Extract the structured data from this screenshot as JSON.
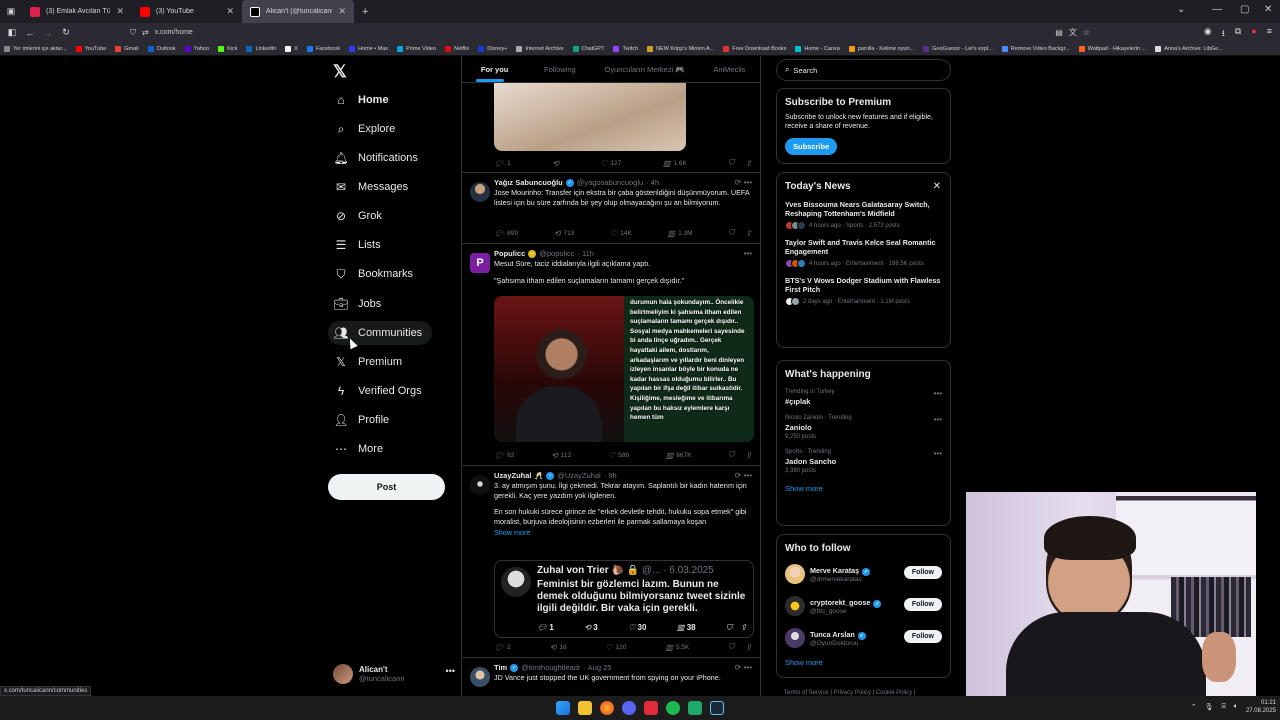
{
  "browser": {
    "tabs": [
      {
        "title": "(3) Emlak Avcıları Türkiye - 8. B",
        "fav_color": "#e0234e"
      },
      {
        "title": "(3) YouTube",
        "fav_color": "#ff0000"
      },
      {
        "title": "Alican't (@tuncalicann) / X",
        "fav_color": "#ffffff",
        "active": true
      }
    ],
    "new_tab": "+",
    "url": "x.com/home",
    "bookmarks": [
      {
        "label": "Yer imlerini içe aktar...",
        "color": "#888"
      },
      {
        "label": "YouTube",
        "color": "#ff0000"
      },
      {
        "label": "Gmail",
        "color": "#ea4335"
      },
      {
        "label": "Outlook",
        "color": "#0a64d6"
      },
      {
        "label": "Yahoo",
        "color": "#6001d2"
      },
      {
        "label": "Kick",
        "color": "#53fc18"
      },
      {
        "label": "LinkedIn",
        "color": "#0a66c2"
      },
      {
        "label": "X",
        "color": "#ffffff"
      },
      {
        "label": "Facebook",
        "color": "#1877f2"
      },
      {
        "label": "Home • Max",
        "color": "#2c3cff"
      },
      {
        "label": "Prime Video",
        "color": "#00a8e1"
      },
      {
        "label": "Netflix",
        "color": "#e50914"
      },
      {
        "label": "Disney+",
        "color": "#113ccf"
      },
      {
        "label": "Internet Archive",
        "color": "#aaaaaa"
      },
      {
        "label": "ChatGPT",
        "color": "#10a37f"
      },
      {
        "label": "Twitch",
        "color": "#9146ff"
      },
      {
        "label": "NEW Kripp's Minion A...",
        "color": "#c9a227"
      },
      {
        "label": "Free Download Books",
        "color": "#d33"
      },
      {
        "label": "Home - Canva",
        "color": "#00c4cc"
      },
      {
        "label": "parolla - Kelime oyun...",
        "color": "#f39c12"
      },
      {
        "label": "GeoGuessr - Let's expl...",
        "color": "#5b2d8e"
      },
      {
        "label": "Remove Video Backgr...",
        "color": "#4a8cff"
      },
      {
        "label": "Wattpad - Hikayelerin ...",
        "color": "#ff6122"
      },
      {
        "label": "Anna's Archive: LibGe...",
        "color": "#dddddd"
      }
    ]
  },
  "leftnav": {
    "items": [
      {
        "label": "Home",
        "icon": "home-icon"
      },
      {
        "label": "Explore",
        "icon": "search-icon"
      },
      {
        "label": "Notifications",
        "icon": "bell-icon"
      },
      {
        "label": "Messages",
        "icon": "mail-icon"
      },
      {
        "label": "Grok",
        "icon": "grok-icon"
      },
      {
        "label": "Lists",
        "icon": "list-icon"
      },
      {
        "label": "Bookmarks",
        "icon": "bookmark-icon"
      },
      {
        "label": "Jobs",
        "icon": "briefcase-icon"
      },
      {
        "label": "Communities",
        "icon": "people-icon"
      },
      {
        "label": "Premium",
        "icon": "x-premium-icon"
      },
      {
        "label": "Verified Orgs",
        "icon": "lightning-icon"
      },
      {
        "label": "Profile",
        "icon": "person-icon"
      },
      {
        "label": "More",
        "icon": "more-circle-icon"
      }
    ],
    "post_label": "Post",
    "account": {
      "name": "Alican't",
      "handle": "@tuncalicann"
    }
  },
  "timeline": {
    "tabs": [
      "For you",
      "Following",
      "Oyuncuların Merkezi 🎮",
      "AniMeclis"
    ],
    "tweets": [
      {
        "stats": {
          "reply": "1",
          "retweet": "",
          "like": "127",
          "views": "1.6K"
        }
      },
      {
        "name": "Yağız Sabuncuoğlu",
        "handle": "@yagosabuncuoglu",
        "time": "· 4h",
        "text": "Jose Mourinho: Transfer için ekstra bir çaba gösterildiğini düşünmüyorum. UEFA listesi için bu süre zarfında bir şey olup olmayacağını şu an bilmiyorum.",
        "stats": {
          "reply": "899",
          "retweet": "713",
          "like": "14K",
          "views": "1.3M"
        }
      },
      {
        "name": "Populicc",
        "handle": "@populicc",
        "time": "· 11h",
        "text": "Mesut Süre, taciz iddialarıyla ilgili açıklama yaptı.",
        "text2": "\"Şahsıma itham edilen suçlamaların tamamı gerçek dışıdır.\"",
        "image_text": "durumun hala şokundayım.. Öncelikle belirtmeliyim ki şahsıma itham edilen suçlamaların tamamı gerçek dışıdır.. Sosyal medya mahkemeleri sayesinde bi anda linçe uğradım.. Gerçek hayattaki ailem, dostlarım, arkadaşlarım ve yıllardır beni dinleyen izleyen insanlar böyle bir konuda ne kadar hassas olduğumu bilirler.. Bu yapılan bir ifşa değil itibar suikastidir. Kişiliğime, mesleğime ve itibarıma yapılan bu haksız eylemlere karşı hemen tüm",
        "stats": {
          "reply": "62",
          "retweet": "112",
          "like": "586",
          "views": "667K"
        }
      },
      {
        "name": "UzayZuhal",
        "handle": "@UzayZuhal",
        "time": "· 9h",
        "text": "3. ay atmışım şunu. İlgi çekmedi. Tekrar atayım. Saplantılı bir kadın haterım için gerekli. Kaç yere yazdım yok ilgilenen.",
        "text2": "En son hukuki sürece girince de \"erkek devletle tehdit, hukuku sopa etmek\" gibi moralist, burjuva ideolojisinin ezberleri ile parmak sallamaya koşan",
        "show_more": "Show more",
        "quote": {
          "name": "Zuhal von Trier 🐌 🔒",
          "handle": "@...",
          "time": "· 6.03.2025",
          "text": "Feminist bir gözlemci lazım. Bunun ne demek olduğunu bilmiyorsanız tweet sizinle ilgili değildir. Bir vaka için gerekli.",
          "stats": {
            "reply": "1",
            "retweet": "3",
            "like": "30",
            "views": "38"
          }
        },
        "stats": {
          "reply": "2",
          "retweet": "16",
          "like": "120",
          "views": "5.5K"
        }
      },
      {
        "name": "Tim",
        "handle": "@timthoughtleadr",
        "time": "· Aug 25",
        "text": "JD Vance just stopped the UK government from spying on your iPhone."
      }
    ]
  },
  "rightcol": {
    "search_placeholder": "Search",
    "premium": {
      "title": "Subscribe to Premium",
      "text": "Subscribe to unlock new features and if eligible, receive a share of revenue.",
      "button": "Subscribe"
    },
    "news": {
      "title": "Today's News",
      "items": [
        {
          "title": "Yves Bissouma Nears Galatasaray Switch, Reshaping Tottenham's Midfield",
          "meta": "4 hours ago · Sports · 2,573 posts"
        },
        {
          "title": "Taylor Swift and Travis Kelce Seal Romantic Engagement",
          "meta": "4 hours ago · Entertainment · 198.5K posts"
        },
        {
          "title": "BTS's V Wows Dodger Stadium with Flawless First Pitch",
          "meta": "2 days ago · Entertainment · 1.1M posts"
        }
      ]
    },
    "happening": {
      "title": "What's happening",
      "trends": [
        {
          "context": "Trending in Turkey",
          "name": "#çıplak",
          "count": ""
        },
        {
          "context": "Nicolo Zaniolo · Trending",
          "name": "Zaniolo",
          "count": "9,250 posts"
        },
        {
          "context": "Sports · Trending",
          "name": "Jadon Sancho",
          "count": "3,390 posts"
        }
      ],
      "show_more": "Show more"
    },
    "who_to_follow": {
      "title": "Who to follow",
      "users": [
        {
          "name": "Merve Karataş",
          "handle": "@drmervekaratas",
          "button": "Follow"
        },
        {
          "name": "cryptorekt_goose",
          "handle": "@btc_goose",
          "button": "Follow"
        },
        {
          "name": "Tunca Arslan",
          "handle": "@OyunDoktoruu",
          "button": "Follow"
        }
      ],
      "show_more": "Show more"
    },
    "footer": "Terms of Service  |  Privacy Policy  |  Cookie Policy  |"
  },
  "status_url": "x.com/tuncalicann/communities",
  "taskbar": {
    "clock_time": "01:21",
    "clock_date": "27.08.2025"
  }
}
